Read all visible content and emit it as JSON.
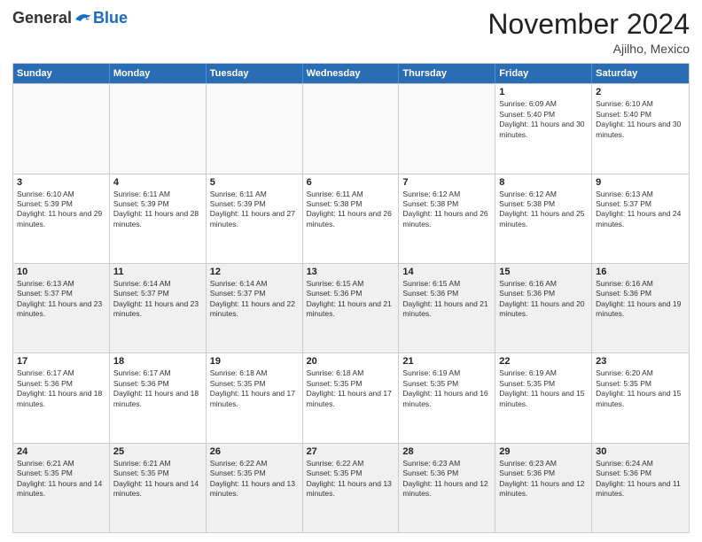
{
  "header": {
    "logo_general": "General",
    "logo_blue": "Blue",
    "title": "November 2024",
    "location": "Ajilho, Mexico"
  },
  "weekdays": [
    "Sunday",
    "Monday",
    "Tuesday",
    "Wednesday",
    "Thursday",
    "Friday",
    "Saturday"
  ],
  "rows": [
    [
      {
        "day": "",
        "info": "",
        "empty": true
      },
      {
        "day": "",
        "info": "",
        "empty": true
      },
      {
        "day": "",
        "info": "",
        "empty": true
      },
      {
        "day": "",
        "info": "",
        "empty": true
      },
      {
        "day": "",
        "info": "",
        "empty": true
      },
      {
        "day": "1",
        "info": "Sunrise: 6:09 AM\nSunset: 5:40 PM\nDaylight: 11 hours and 30 minutes."
      },
      {
        "day": "2",
        "info": "Sunrise: 6:10 AM\nSunset: 5:40 PM\nDaylight: 11 hours and 30 minutes."
      }
    ],
    [
      {
        "day": "3",
        "info": "Sunrise: 6:10 AM\nSunset: 5:39 PM\nDaylight: 11 hours and 29 minutes."
      },
      {
        "day": "4",
        "info": "Sunrise: 6:11 AM\nSunset: 5:39 PM\nDaylight: 11 hours and 28 minutes."
      },
      {
        "day": "5",
        "info": "Sunrise: 6:11 AM\nSunset: 5:39 PM\nDaylight: 11 hours and 27 minutes."
      },
      {
        "day": "6",
        "info": "Sunrise: 6:11 AM\nSunset: 5:38 PM\nDaylight: 11 hours and 26 minutes."
      },
      {
        "day": "7",
        "info": "Sunrise: 6:12 AM\nSunset: 5:38 PM\nDaylight: 11 hours and 26 minutes."
      },
      {
        "day": "8",
        "info": "Sunrise: 6:12 AM\nSunset: 5:38 PM\nDaylight: 11 hours and 25 minutes."
      },
      {
        "day": "9",
        "info": "Sunrise: 6:13 AM\nSunset: 5:37 PM\nDaylight: 11 hours and 24 minutes."
      }
    ],
    [
      {
        "day": "10",
        "info": "Sunrise: 6:13 AM\nSunset: 5:37 PM\nDaylight: 11 hours and 23 minutes.",
        "shaded": true
      },
      {
        "day": "11",
        "info": "Sunrise: 6:14 AM\nSunset: 5:37 PM\nDaylight: 11 hours and 23 minutes.",
        "shaded": true
      },
      {
        "day": "12",
        "info": "Sunrise: 6:14 AM\nSunset: 5:37 PM\nDaylight: 11 hours and 22 minutes.",
        "shaded": true
      },
      {
        "day": "13",
        "info": "Sunrise: 6:15 AM\nSunset: 5:36 PM\nDaylight: 11 hours and 21 minutes.",
        "shaded": true
      },
      {
        "day": "14",
        "info": "Sunrise: 6:15 AM\nSunset: 5:36 PM\nDaylight: 11 hours and 21 minutes.",
        "shaded": true
      },
      {
        "day": "15",
        "info": "Sunrise: 6:16 AM\nSunset: 5:36 PM\nDaylight: 11 hours and 20 minutes.",
        "shaded": true
      },
      {
        "day": "16",
        "info": "Sunrise: 6:16 AM\nSunset: 5:36 PM\nDaylight: 11 hours and 19 minutes.",
        "shaded": true
      }
    ],
    [
      {
        "day": "17",
        "info": "Sunrise: 6:17 AM\nSunset: 5:36 PM\nDaylight: 11 hours and 18 minutes."
      },
      {
        "day": "18",
        "info": "Sunrise: 6:17 AM\nSunset: 5:36 PM\nDaylight: 11 hours and 18 minutes."
      },
      {
        "day": "19",
        "info": "Sunrise: 6:18 AM\nSunset: 5:35 PM\nDaylight: 11 hours and 17 minutes."
      },
      {
        "day": "20",
        "info": "Sunrise: 6:18 AM\nSunset: 5:35 PM\nDaylight: 11 hours and 17 minutes."
      },
      {
        "day": "21",
        "info": "Sunrise: 6:19 AM\nSunset: 5:35 PM\nDaylight: 11 hours and 16 minutes."
      },
      {
        "day": "22",
        "info": "Sunrise: 6:19 AM\nSunset: 5:35 PM\nDaylight: 11 hours and 15 minutes."
      },
      {
        "day": "23",
        "info": "Sunrise: 6:20 AM\nSunset: 5:35 PM\nDaylight: 11 hours and 15 minutes."
      }
    ],
    [
      {
        "day": "24",
        "info": "Sunrise: 6:21 AM\nSunset: 5:35 PM\nDaylight: 11 hours and 14 minutes.",
        "shaded": true
      },
      {
        "day": "25",
        "info": "Sunrise: 6:21 AM\nSunset: 5:35 PM\nDaylight: 11 hours and 14 minutes.",
        "shaded": true
      },
      {
        "day": "26",
        "info": "Sunrise: 6:22 AM\nSunset: 5:35 PM\nDaylight: 11 hours and 13 minutes.",
        "shaded": true
      },
      {
        "day": "27",
        "info": "Sunrise: 6:22 AM\nSunset: 5:35 PM\nDaylight: 11 hours and 13 minutes.",
        "shaded": true
      },
      {
        "day": "28",
        "info": "Sunrise: 6:23 AM\nSunset: 5:36 PM\nDaylight: 11 hours and 12 minutes.",
        "shaded": true
      },
      {
        "day": "29",
        "info": "Sunrise: 6:23 AM\nSunset: 5:36 PM\nDaylight: 11 hours and 12 minutes.",
        "shaded": true
      },
      {
        "day": "30",
        "info": "Sunrise: 6:24 AM\nSunset: 5:36 PM\nDaylight: 11 hours and 11 minutes.",
        "shaded": true
      }
    ]
  ]
}
